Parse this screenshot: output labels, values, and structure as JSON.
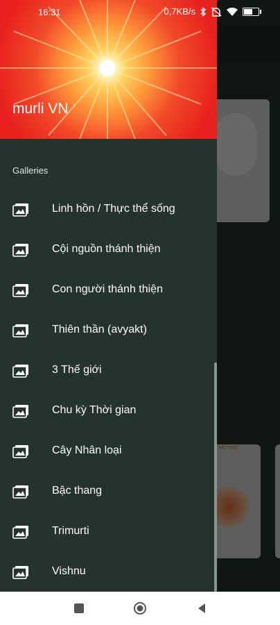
{
  "status_bar": {
    "time": "16:31",
    "speed": "0,7KB/s",
    "icons": [
      "bluetooth-icon",
      "no-sim-icon",
      "wifi-icon",
      "battery-icon"
    ],
    "battery_level": 0.55
  },
  "drawer": {
    "app_name": "murli VN",
    "section_label": "Galleries",
    "items": [
      {
        "label": "Linh hồn / Thực thể sống",
        "icon": "gallery-icon"
      },
      {
        "label": "Cội nguồn thánh thiện",
        "icon": "gallery-icon"
      },
      {
        "label": "Con người thánh thiện",
        "icon": "gallery-icon"
      },
      {
        "label": "Thiên thần (avyakt)",
        "icon": "gallery-icon"
      },
      {
        "label": "3 Thế giới",
        "icon": "gallery-icon"
      },
      {
        "label": "Chu kỳ Thời gian",
        "icon": "gallery-icon"
      },
      {
        "label": "Cây Nhân loại",
        "icon": "gallery-icon"
      },
      {
        "label": "Bậc thang",
        "icon": "gallery-icon"
      },
      {
        "label": "Trimurti",
        "icon": "gallery-icon"
      },
      {
        "label": "Vishnu",
        "icon": "gallery-icon"
      }
    ]
  },
  "nav_bar": {
    "buttons": [
      "recents-button",
      "home-button",
      "back-button"
    ]
  },
  "colors": {
    "drawer_bg": "#24332b",
    "header_red": "#e02020",
    "accent_white": "#ffffff"
  }
}
